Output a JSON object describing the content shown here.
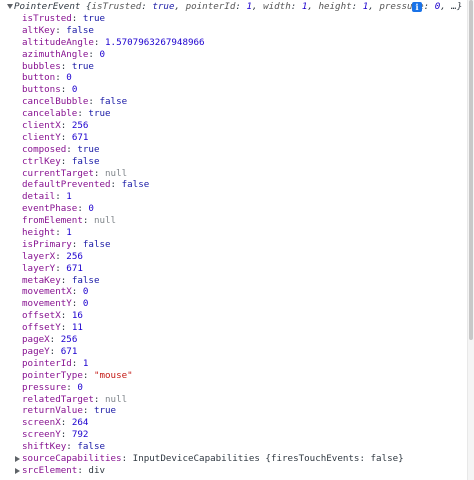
{
  "header": {
    "class_name": "PointerEvent",
    "summary_prefix": " {",
    "preview": [
      {
        "key": "isTrusted",
        "value": "true",
        "kind": "bool"
      },
      {
        "key": "pointerId",
        "value": "1",
        "kind": "num"
      },
      {
        "key": "width",
        "value": "1",
        "kind": "num"
      },
      {
        "key": "height",
        "value": "1",
        "kind": "num"
      },
      {
        "key": "pressure",
        "value": "0",
        "kind": "num"
      }
    ],
    "summary_suffix": ", …}",
    "info_icon": "info-icon",
    "info_glyph": "i"
  },
  "properties": [
    {
      "key": "isTrusted",
      "value": "true",
      "kind": "bool"
    },
    {
      "key": "altKey",
      "value": "false",
      "kind": "bool"
    },
    {
      "key": "altitudeAngle",
      "value": "1.5707963267948966",
      "kind": "num"
    },
    {
      "key": "azimuthAngle",
      "value": "0",
      "kind": "num"
    },
    {
      "key": "bubbles",
      "value": "true",
      "kind": "bool"
    },
    {
      "key": "button",
      "value": "0",
      "kind": "num"
    },
    {
      "key": "buttons",
      "value": "0",
      "kind": "num"
    },
    {
      "key": "cancelBubble",
      "value": "false",
      "kind": "bool"
    },
    {
      "key": "cancelable",
      "value": "true",
      "kind": "bool"
    },
    {
      "key": "clientX",
      "value": "256",
      "kind": "num"
    },
    {
      "key": "clientY",
      "value": "671",
      "kind": "num"
    },
    {
      "key": "composed",
      "value": "true",
      "kind": "bool"
    },
    {
      "key": "ctrlKey",
      "value": "false",
      "kind": "bool"
    },
    {
      "key": "currentTarget",
      "value": "null",
      "kind": "null"
    },
    {
      "key": "defaultPrevented",
      "value": "false",
      "kind": "bool"
    },
    {
      "key": "detail",
      "value": "1",
      "kind": "num"
    },
    {
      "key": "eventPhase",
      "value": "0",
      "kind": "num"
    },
    {
      "key": "fromElement",
      "value": "null",
      "kind": "null"
    },
    {
      "key": "height",
      "value": "1",
      "kind": "num"
    },
    {
      "key": "isPrimary",
      "value": "false",
      "kind": "bool"
    },
    {
      "key": "layerX",
      "value": "256",
      "kind": "num"
    },
    {
      "key": "layerY",
      "value": "671",
      "kind": "num"
    },
    {
      "key": "metaKey",
      "value": "false",
      "kind": "bool"
    },
    {
      "key": "movementX",
      "value": "0",
      "kind": "num"
    },
    {
      "key": "movementY",
      "value": "0",
      "kind": "num"
    },
    {
      "key": "offsetX",
      "value": "16",
      "kind": "num"
    },
    {
      "key": "offsetY",
      "value": "11",
      "kind": "num"
    },
    {
      "key": "pageX",
      "value": "256",
      "kind": "num"
    },
    {
      "key": "pageY",
      "value": "671",
      "kind": "num"
    },
    {
      "key": "pointerId",
      "value": "1",
      "kind": "num"
    },
    {
      "key": "pointerType",
      "value": "\"mouse\"",
      "kind": "str"
    },
    {
      "key": "pressure",
      "value": "0",
      "kind": "num"
    },
    {
      "key": "relatedTarget",
      "value": "null",
      "kind": "null"
    },
    {
      "key": "returnValue",
      "value": "true",
      "kind": "bool"
    },
    {
      "key": "screenX",
      "value": "264",
      "kind": "num"
    },
    {
      "key": "screenY",
      "value": "792",
      "kind": "num"
    },
    {
      "key": "shiftKey",
      "value": "false",
      "kind": "bool"
    },
    {
      "key": "sourceCapabilities",
      "value": "InputDeviceCapabilities {firesTouchEvents: false}",
      "kind": "obj",
      "expandable": true
    },
    {
      "key": "srcElement",
      "value": "div",
      "kind": "obj",
      "expandable": true
    }
  ],
  "colors": {
    "key": "#881391",
    "bool": "#1a1aa6",
    "num": "#1c00cf",
    "str": "#c41a16",
    "null": "#80868b",
    "text": "#303942"
  }
}
